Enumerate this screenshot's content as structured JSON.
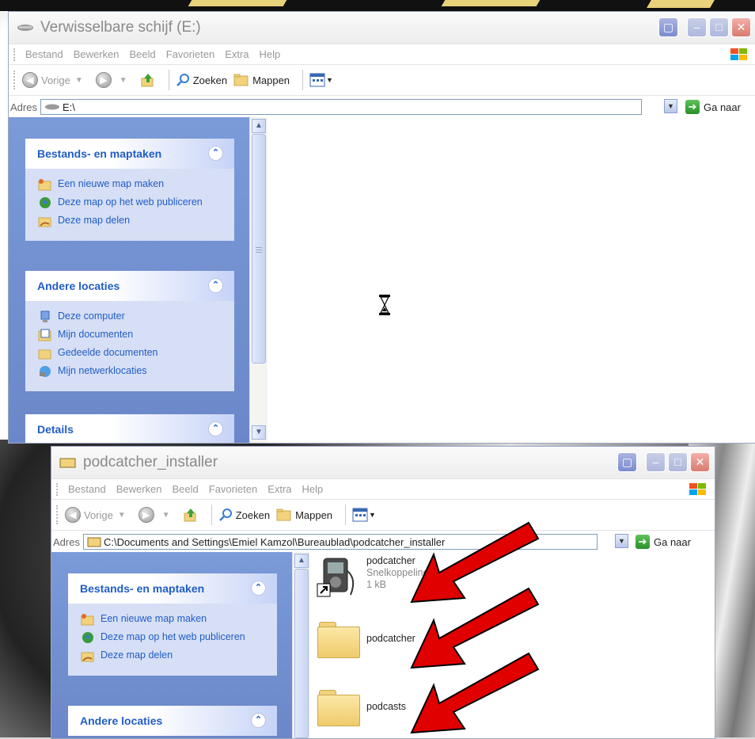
{
  "window_top": {
    "title": "Verwisselbare schijf (E:)",
    "menu": [
      "Bestand",
      "Bewerken",
      "Beeld",
      "Favorieten",
      "Extra",
      "Help"
    ],
    "toolbar": {
      "back": "Vorige",
      "search": "Zoeken",
      "folders": "Mappen"
    },
    "address": {
      "label": "Adres",
      "value": "E:\\",
      "go": "Ga naar"
    },
    "panels": {
      "file_tasks": {
        "title": "Bestands- en maptaken",
        "items": [
          "Een nieuwe map maken",
          "Deze map op het web publiceren",
          "Deze map delen"
        ]
      },
      "other_places": {
        "title": "Andere locaties",
        "items": [
          "Deze computer",
          "Mijn documenten",
          "Gedeelde documenten",
          "Mijn netwerklocaties"
        ]
      },
      "details": {
        "title": "Details"
      }
    }
  },
  "window_bottom": {
    "title": "podcatcher_installer",
    "menu": [
      "Bestand",
      "Bewerken",
      "Beeld",
      "Favorieten",
      "Extra",
      "Help"
    ],
    "toolbar": {
      "back": "Vorige",
      "search": "Zoeken",
      "folders": "Mappen"
    },
    "address": {
      "label": "Adres",
      "value": "C:\\Documents and Settings\\Emiel Kamzol\\Bureaublad\\podcatcher_installer",
      "go": "Ga naar"
    },
    "panels": {
      "file_tasks": {
        "title": "Bestands- en maptaken",
        "items": [
          "Een nieuwe map maken",
          "Deze map op het web publiceren",
          "Deze map delen"
        ]
      },
      "other_places": {
        "title": "Andere locaties"
      }
    },
    "files": [
      {
        "name": "podcatcher",
        "type": "Snelkoppeling",
        "size": "1 kB",
        "icon": "shortcut-ipod-icon"
      },
      {
        "name": "podcatcher",
        "icon": "folder-icon"
      },
      {
        "name": "podcasts",
        "icon": "folder-icon"
      }
    ]
  },
  "colors": {
    "annotation_arrow": "#e00000",
    "task_link": "#215dc6",
    "taskpane_bg": "#6b87c9"
  }
}
